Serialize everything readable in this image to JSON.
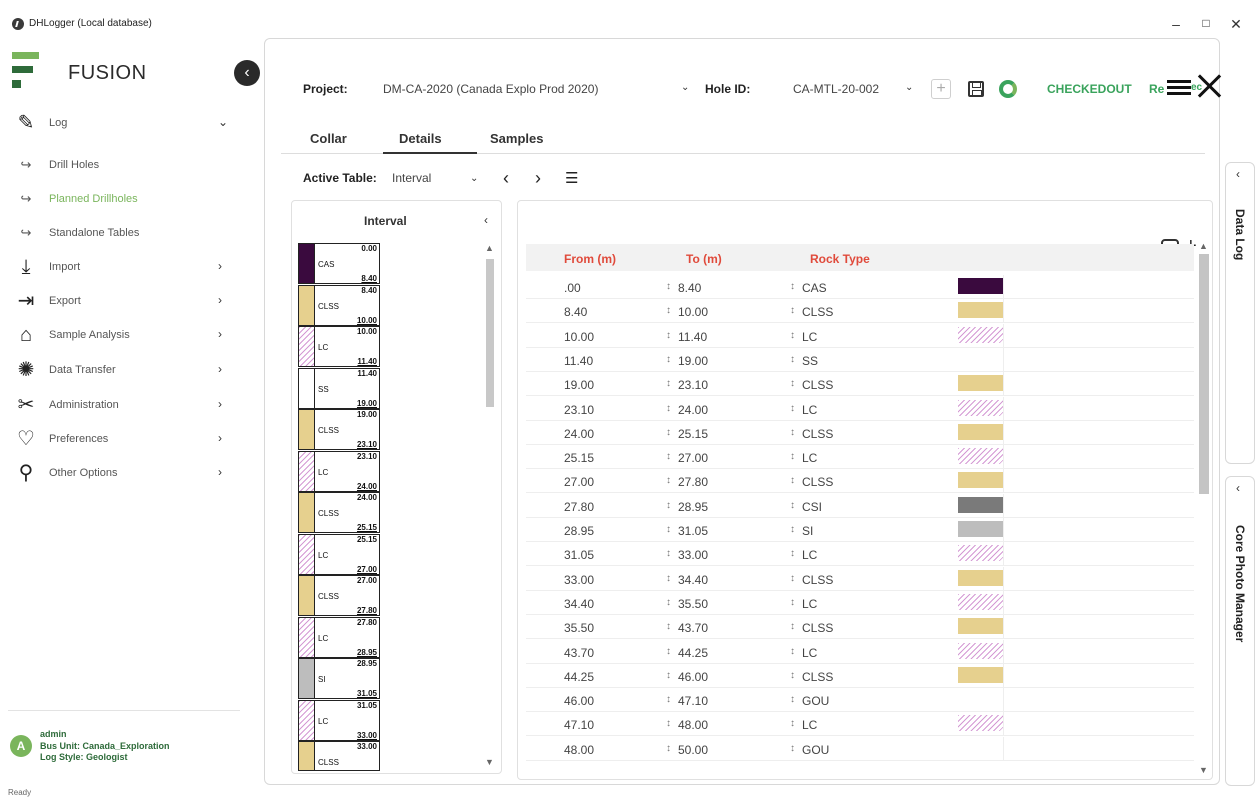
{
  "window": {
    "title": "DHLogger (Local database)",
    "minimize": "–",
    "maximize": "□",
    "close": "✕"
  },
  "sidebar": {
    "brand": "FUSION",
    "collapse_glyph": "‹",
    "items": [
      {
        "label": "Log",
        "icon": "edit-icon",
        "glyph": "✎",
        "chevron": "⌄"
      },
      {
        "label": "Drill Holes",
        "icon": "arrow-right-icon",
        "glyph": "↪"
      },
      {
        "label": "Planned Drillholes",
        "icon": "arrow-right-icon",
        "glyph": "↪"
      },
      {
        "label": "Standalone Tables",
        "icon": "arrow-right-icon",
        "glyph": "↪"
      },
      {
        "label": "Import",
        "icon": "import-icon",
        "glyph": "⤓",
        "chevron": "›"
      },
      {
        "label": "Export",
        "icon": "export-icon",
        "glyph": "⇥",
        "chevron": "›"
      },
      {
        "label": "Sample Analysis",
        "icon": "tag-icon",
        "glyph": "⌂",
        "chevron": "›"
      },
      {
        "label": "Data Transfer",
        "icon": "loading-icon",
        "glyph": "✺",
        "chevron": "›"
      },
      {
        "label": "Administration",
        "icon": "tools-icon",
        "glyph": "✂",
        "chevron": "›"
      },
      {
        "label": "Preferences",
        "icon": "preferences-icon",
        "glyph": "♡",
        "chevron": "›"
      },
      {
        "label": "Other Options",
        "icon": "options-icon",
        "glyph": "⚲",
        "chevron": "›"
      }
    ],
    "user": {
      "avatar": "A",
      "name": "admin",
      "bus_unit": "Bus Unit: Canada_Exploration",
      "log_style": "Log Style: Geologist"
    }
  },
  "header": {
    "project_label": "Project:",
    "project_value": "DM-CA-2020 (Canada Explo Prod 2020)",
    "hole_label": "Hole ID:",
    "hole_value": "CA-MTL-20-002",
    "chevron": "⌄",
    "add_glyph": "+",
    "status": "CHECKEDOUT",
    "extra": "Re",
    "extra2": "ec"
  },
  "tabs": {
    "collar": "Collar",
    "details": "Details",
    "samples": "Samples"
  },
  "active_table": {
    "label": "Active Table:",
    "value": "Interval",
    "prev": "‹",
    "next": "›",
    "list_glyph": "☰"
  },
  "interval_panel": {
    "title": "Interval",
    "back": "‹",
    "rows": [
      {
        "code": "CAS",
        "from": "0.00",
        "to": "8.40",
        "color": "#3a0a3e",
        "pattern": "solid"
      },
      {
        "code": "CLSS",
        "from": "8.40",
        "to": "10.00",
        "color": "#e6d08e",
        "pattern": "solid"
      },
      {
        "code": "LC",
        "from": "10.00",
        "to": "11.40",
        "color": "#ffffff",
        "pattern": "lc"
      },
      {
        "code": "SS",
        "from": "11.40",
        "to": "19.00",
        "color": "#ffffff",
        "pattern": "solid"
      },
      {
        "code": "CLSS",
        "from": "19.00",
        "to": "23.10",
        "color": "#e6d08e",
        "pattern": "solid"
      },
      {
        "code": "LC",
        "from": "23.10",
        "to": "24.00",
        "color": "#ffffff",
        "pattern": "lc"
      },
      {
        "code": "CLSS",
        "from": "24.00",
        "to": "25.15",
        "color": "#e6d08e",
        "pattern": "solid"
      },
      {
        "code": "LC",
        "from": "25.15",
        "to": "27.00",
        "color": "#ffffff",
        "pattern": "lc"
      },
      {
        "code": "CLSS",
        "from": "27.00",
        "to": "27.80",
        "color": "#e6d08e",
        "pattern": "solid"
      },
      {
        "code": "LC",
        "from": "27.80",
        "to": "28.95",
        "color": "#ffffff",
        "pattern": "lc"
      },
      {
        "code": "SI",
        "from": "28.95",
        "to": "31.05",
        "color": "#bdbdbd",
        "pattern": "solid"
      },
      {
        "code": "LC",
        "from": "31.05",
        "to": "33.00",
        "color": "#ffffff",
        "pattern": "lc"
      },
      {
        "code": "CLSS",
        "from": "33.00",
        "to": "",
        "color": "#e6d08e",
        "pattern": "solid"
      }
    ]
  },
  "grid": {
    "columns": [
      "From (m)",
      "To (m)",
      "Rock Type"
    ],
    "header_color": "#e04a3b",
    "spin_glyph": "↕",
    "rows": [
      {
        "from": ".00",
        "to": "8.40",
        "rock": "CAS",
        "color": "#3a0a3e",
        "pattern": "solid"
      },
      {
        "from": "8.40",
        "to": "10.00",
        "rock": "CLSS",
        "color": "#e6d08e",
        "pattern": "solid"
      },
      {
        "from": "10.00",
        "to": "11.40",
        "rock": "LC",
        "color": "",
        "pattern": "lc"
      },
      {
        "from": "11.40",
        "to": "19.00",
        "rock": "SS",
        "color": "",
        "pattern": "none"
      },
      {
        "from": "19.00",
        "to": "23.10",
        "rock": "CLSS",
        "color": "#e6d08e",
        "pattern": "solid"
      },
      {
        "from": "23.10",
        "to": "24.00",
        "rock": "LC",
        "color": "",
        "pattern": "lc"
      },
      {
        "from": "24.00",
        "to": "25.15",
        "rock": "CLSS",
        "color": "#e6d08e",
        "pattern": "solid"
      },
      {
        "from": "25.15",
        "to": "27.00",
        "rock": "LC",
        "color": "",
        "pattern": "lc"
      },
      {
        "from": "27.00",
        "to": "27.80",
        "rock": "CLSS",
        "color": "#e6d08e",
        "pattern": "solid"
      },
      {
        "from": "27.80",
        "to": "28.95",
        "rock": "CSI",
        "color": "#7a7a7a",
        "pattern": "solid"
      },
      {
        "from": "28.95",
        "to": "31.05",
        "rock": "SI",
        "color": "#bdbdbd",
        "pattern": "solid"
      },
      {
        "from": "31.05",
        "to": "33.00",
        "rock": "LC",
        "color": "",
        "pattern": "lc"
      },
      {
        "from": "33.00",
        "to": "34.40",
        "rock": "CLSS",
        "color": "#e6d08e",
        "pattern": "solid"
      },
      {
        "from": "34.40",
        "to": "35.50",
        "rock": "LC",
        "color": "",
        "pattern": "lc"
      },
      {
        "from": "35.50",
        "to": "43.70",
        "rock": "CLSS",
        "color": "#e6d08e",
        "pattern": "solid"
      },
      {
        "from": "43.70",
        "to": "44.25",
        "rock": "LC",
        "color": "",
        "pattern": "lc"
      },
      {
        "from": "44.25",
        "to": "46.00",
        "rock": "CLSS",
        "color": "#e6d08e",
        "pattern": "solid"
      },
      {
        "from": "46.00",
        "to": "47.10",
        "rock": "GOU",
        "color": "",
        "pattern": "none"
      },
      {
        "from": "47.10",
        "to": "48.00",
        "rock": "LC",
        "color": "",
        "pattern": "lc"
      },
      {
        "from": "48.00",
        "to": "50.00",
        "rock": "GOU",
        "color": "",
        "pattern": "none"
      }
    ]
  },
  "side_tabs": {
    "data_log": "Data Log",
    "core_photo": "Core Photo Manager",
    "arrow": "‹"
  },
  "status_bar": "Ready"
}
